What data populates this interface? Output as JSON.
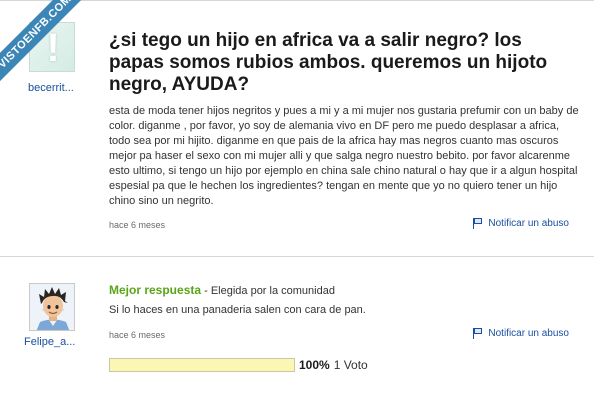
{
  "watermark": "VISTOENFB.COM",
  "question": {
    "asker_name": "becerrit...",
    "asker_avatar_glyph": "!",
    "title": "¿si tego un hijo en africa va a salir negro? los papas somos rubios ambos. queremos un hijoto negro, AYUDA?",
    "body": "esta de moda tener hijos negritos y pues a mi y a mi mujer nos gustaria prefumir con un baby de color. diganme , por favor, yo soy de alemania vivo en DF pero me puedo desplasar a africa, todo sea por mi hijito. diganme en que pais de la africa hay mas negros cuanto mas oscuros mejor pa haser el sexo con mi mujer alli y que salga negro nuestro bebito. por favor alcarenme esto ultimo, si tengo un hijo por ejemplo en china sale chino natural o hay que ir a algun hospital espesial pa que le hechen los ingredientes? tengan en mente que yo no quiero tener un hijo chino sino un negrito.",
    "time": "hace 6 meses",
    "report_label": "Notificar un abuso"
  },
  "answer": {
    "best_label": "Mejor respuesta",
    "chosen_by": " - Elegida por la comunidad",
    "answerer_name": "Felipe_a...",
    "text": "Si lo haces en una panaderia salen con cara de pan.",
    "time": "hace 6 meses",
    "report_label": "Notificar un abuso",
    "vote_percent_label": "100%",
    "vote_fraction": 1.0,
    "vote_count_label": "1 Voto"
  },
  "colors": {
    "link_blue": "#1a4fa0",
    "best_green": "#5aa41a",
    "ribbon_blue": "#3b86b6",
    "vote_bar_yellow": "#fdfbd2"
  }
}
